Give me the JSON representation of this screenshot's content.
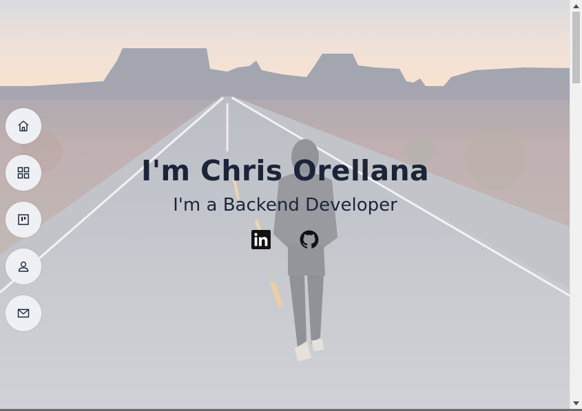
{
  "hero": {
    "title": "I'm Chris Orellana",
    "subtitle": "I'm a Backend Developer"
  },
  "nav": {
    "items": [
      {
        "icon": "home-icon"
      },
      {
        "icon": "grid-icon"
      },
      {
        "icon": "portfolio-icon"
      },
      {
        "icon": "user-icon"
      },
      {
        "icon": "mail-icon"
      }
    ]
  },
  "social": [
    {
      "icon": "linkedin-icon"
    },
    {
      "icon": "github-icon"
    }
  ],
  "colors": {
    "text": "#1c2538",
    "nav_bg": "#eef0f3",
    "sky_top": "#c9c9cf",
    "sky_horizon": "#f1c9a2"
  },
  "scrollbar": {
    "position": 0
  }
}
